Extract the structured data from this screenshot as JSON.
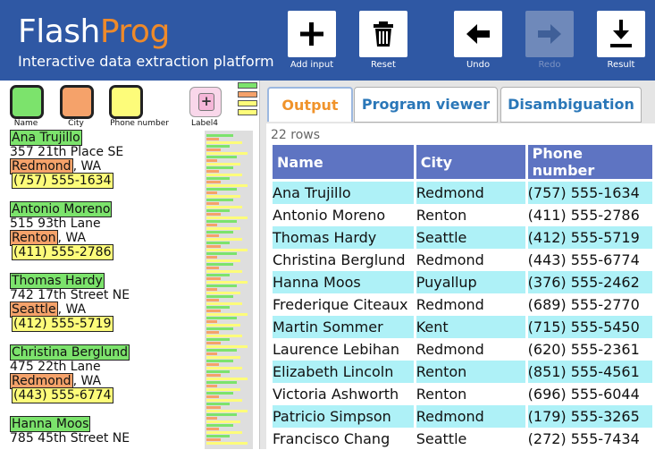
{
  "app": {
    "logo_part1": "Flash",
    "logo_part2": "Prog",
    "subtitle": "Interactive data extraction platform"
  },
  "toolbar": {
    "add_input": "Add input",
    "reset": "Reset",
    "undo": "Undo",
    "redo": "Redo",
    "redo_enabled": false,
    "result": "Result"
  },
  "colors": {
    "header": "#2f58a4",
    "name": "#7ce36c",
    "city": "#f5a26a",
    "phone": "#fdfc7a",
    "label4": "#f5b6d8",
    "table_header": "#5e74c2",
    "row_alt": "#aef1f7"
  },
  "labels": [
    {
      "name": "Name",
      "icon": "name-color-swatch"
    },
    {
      "name": "City",
      "icon": "city-color-swatch"
    },
    {
      "name": "Phone number",
      "icon": "phone-color-swatch"
    },
    {
      "name": "Label4",
      "icon": "plus-icon"
    }
  ],
  "document": [
    {
      "name": "Ana Trujillo",
      "street": "357 21th Place SE",
      "city": "Redmond",
      "state": ", WA",
      "phone": "(757) 555-1634"
    },
    {
      "name": "Antonio Moreno",
      "street": "515 93th Lane",
      "city": "Renton",
      "state": ", WA",
      "phone": "(411) 555-2786"
    },
    {
      "name": "Thomas Hardy",
      "street": "742 17th Street NE",
      "city": "Seattle",
      "state": ", WA",
      "phone": "(412) 555-5719"
    },
    {
      "name": "Christina Berglund",
      "street": "475 22th Lane",
      "city": "Redmond",
      "state": ", WA",
      "phone": "(443) 555-6774"
    },
    {
      "name": "Hanna Moos",
      "street": "785 45th Street NE",
      "city": "",
      "state": "",
      "phone": ""
    }
  ],
  "tabs": [
    {
      "label": "Output",
      "active": true
    },
    {
      "label": "Program viewer",
      "active": false
    },
    {
      "label": "Disambiguation",
      "active": false
    }
  ],
  "output": {
    "row_count": "22 rows",
    "columns": [
      "Name",
      "City",
      "Phone number"
    ],
    "rows": [
      [
        "Ana Trujillo",
        "Redmond",
        "(757) 555-1634"
      ],
      [
        "Antonio Moreno",
        "Renton",
        "(411) 555-2786"
      ],
      [
        "Thomas Hardy",
        "Seattle",
        "(412) 555-5719"
      ],
      [
        "Christina Berglund",
        "Redmond",
        "(443) 555-6774"
      ],
      [
        "Hanna Moos",
        "Puyallup",
        "(376) 555-2462"
      ],
      [
        "Frederique Citeaux",
        "Redmond",
        "(689) 555-2770"
      ],
      [
        "Martin Sommer",
        "Kent",
        "(715) 555-5450"
      ],
      [
        "Laurence Lebihan",
        "Redmond",
        "(620) 555-2361"
      ],
      [
        "Elizabeth Lincoln",
        "Renton",
        "(851) 555-4561"
      ],
      [
        "Victoria Ashworth",
        "Renton",
        "(696) 555-6044"
      ],
      [
        "Patricio Simpson",
        "Redmond",
        "(179) 555-3265"
      ],
      [
        "Francisco Chang",
        "Seattle",
        "(272) 555-7434"
      ]
    ]
  }
}
